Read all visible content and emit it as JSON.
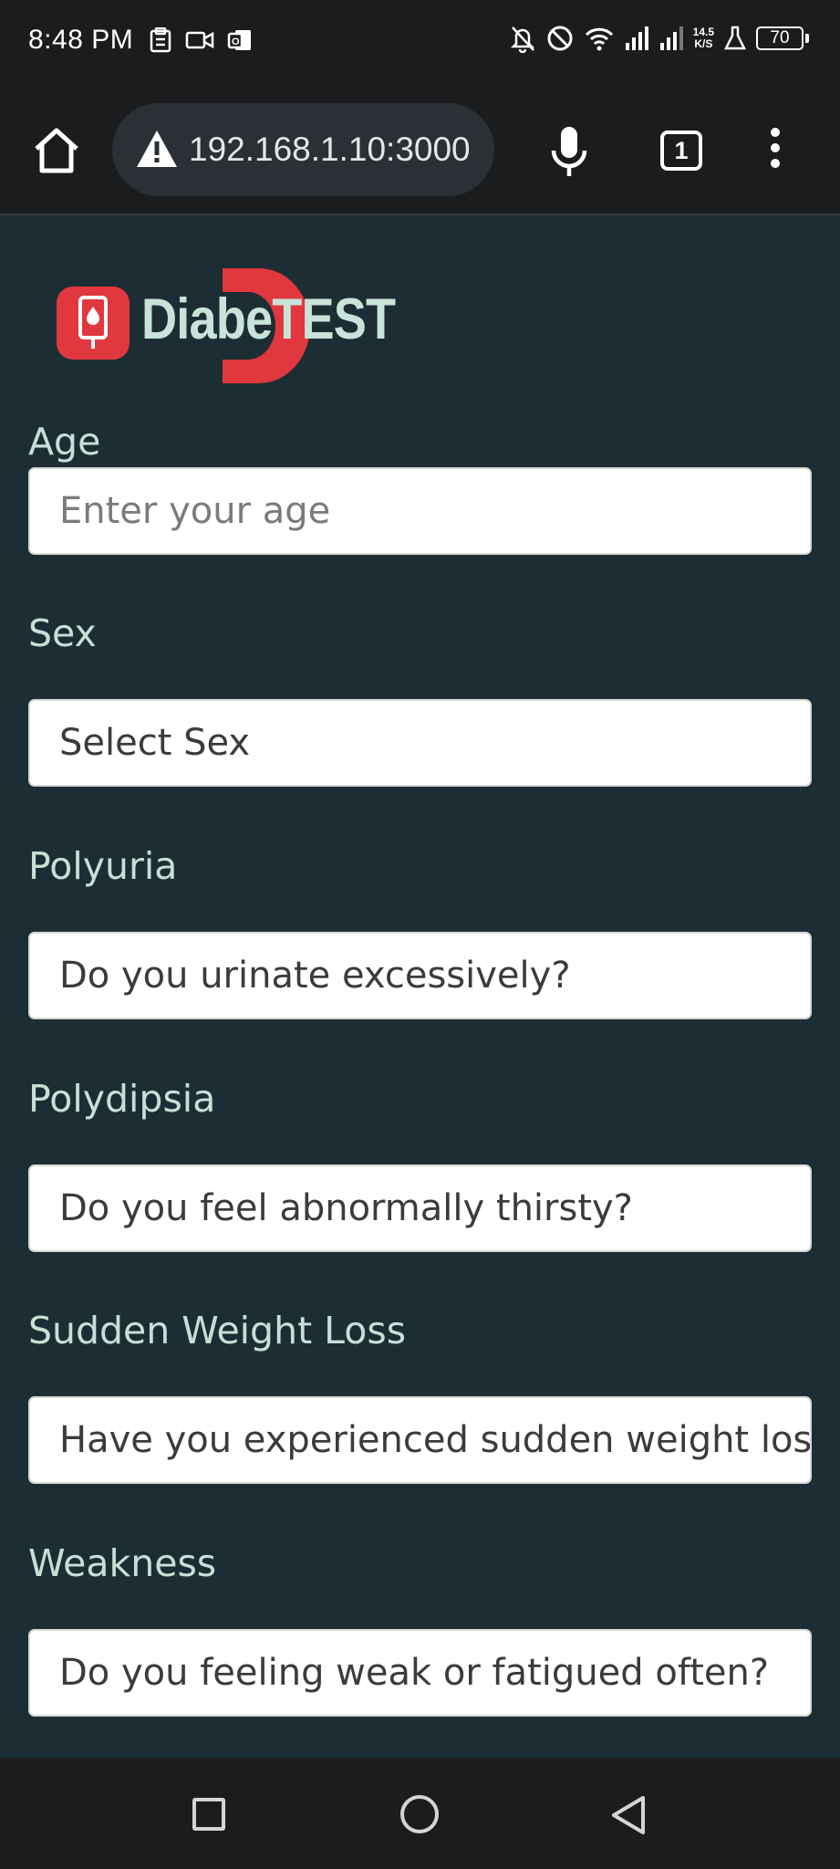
{
  "status_bar": {
    "time": "8:48 PM",
    "speed": "14.5",
    "speed_unit": "K/S",
    "battery": "70",
    "icons": [
      "clipboard-icon",
      "video-icon",
      "outlook-icon",
      "bell-off-icon",
      "do-not-disturb-icon",
      "wifi-icon",
      "signal-icon",
      "signal-2-icon",
      "flask-icon",
      "battery-icon"
    ]
  },
  "browser": {
    "url": "192.168.1.10:3000",
    "tab_count": "1",
    "icons": [
      "home-icon",
      "warning-icon",
      "mic-icon",
      "tabs-icon",
      "menu-icon"
    ]
  },
  "app": {
    "logo_text": "DiabeTEST",
    "brand_color": "#e0383e",
    "background_color": "#1c2e33"
  },
  "form": {
    "age": {
      "label": "Age",
      "placeholder": "Enter your age"
    },
    "sex": {
      "label": "Sex",
      "selected": "Select Sex"
    },
    "polyuria": {
      "label": "Polyuria",
      "placeholder": "Do you urinate excessively?"
    },
    "polydipsia": {
      "label": "Polydipsia",
      "placeholder": "Do you feel abnormally thirsty?"
    },
    "sudden_weight_loss": {
      "label": "Sudden Weight Loss",
      "placeholder": "Have you experienced sudden weight loss?"
    },
    "weakness": {
      "label": "Weakness",
      "placeholder": "Do you feeling weak or fatigued often?"
    }
  },
  "nav": {
    "icons": [
      "recent-apps-icon",
      "home-circle-icon",
      "back-icon"
    ]
  }
}
